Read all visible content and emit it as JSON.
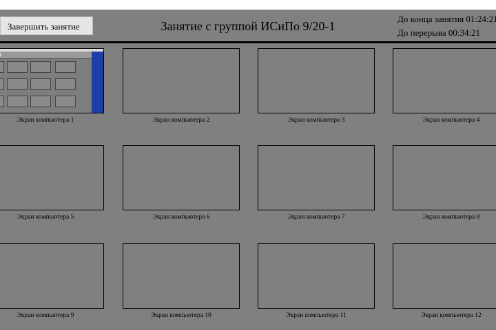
{
  "header": {
    "finish_button": "Завершить занятие",
    "title": "Занятие с группой ИСиПо 9/20-1",
    "time_to_end": "До конца занятия 01:24:21",
    "time_to_break": "До перерыва 00:34:21"
  },
  "screens": [
    {
      "label": "Экран компьютера 1",
      "has_preview": true
    },
    {
      "label": "Экран компьютера 2",
      "has_preview": false
    },
    {
      "label": "Экран компьютера 3",
      "has_preview": false
    },
    {
      "label": "Экран компьютера 4",
      "has_preview": false
    },
    {
      "label": "Экран компьютера 5",
      "has_preview": false
    },
    {
      "label": "Экран компьютера 6",
      "has_preview": false
    },
    {
      "label": "Экран компьютера 7",
      "has_preview": false
    },
    {
      "label": "Экран компьютера 8",
      "has_preview": false
    },
    {
      "label": "Экран компьютера 9",
      "has_preview": false
    },
    {
      "label": "Экран компьютера 10",
      "has_preview": false
    },
    {
      "label": "Экран компьютера 11",
      "has_preview": false
    },
    {
      "label": "Экран компьютера 12",
      "has_preview": false
    }
  ],
  "colors": {
    "background": "#808080",
    "button": "#e6e6e6",
    "preview_accent": "#1f3fa8"
  }
}
